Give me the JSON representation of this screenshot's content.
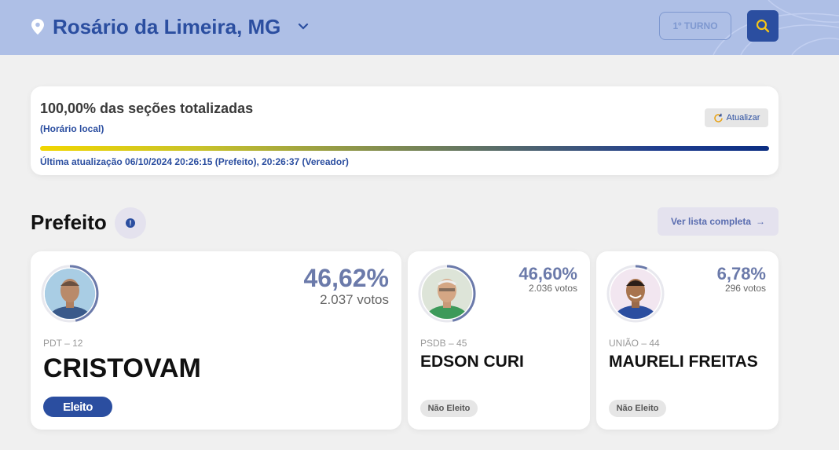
{
  "header": {
    "city": "Rosário da Limeira, MG",
    "turno_label": "1º TURNO"
  },
  "status": {
    "title": "100,00% das seções totalizadas",
    "subtitle": "(Horário local)",
    "refresh_label": "Atualizar",
    "progress": 1.0,
    "last_update": "Última atualização 06/10/2024 20:26:15 (Prefeito), 20:26:37 (Vereador)"
  },
  "section": {
    "title": "Prefeito",
    "info_icon": "!",
    "list_button": "Ver lista completa",
    "list_arrow": "→"
  },
  "candidates": [
    {
      "party": "PDT – 12",
      "name": "CRISTOVAM",
      "percent": "46,62%",
      "votes": "2.037 votos",
      "status": "Eleito",
      "share": 0.4662
    },
    {
      "party": "PSDB – 45",
      "name": "EDSON CURI",
      "percent": "46,60%",
      "votes": "2.036 votos",
      "status": "Não Eleito",
      "share": 0.466
    },
    {
      "party": "UNIÃO – 44",
      "name": "MAURELI FREITAS",
      "percent": "6,78%",
      "votes": "296 votos",
      "status": "Não Eleito",
      "share": 0.0678
    }
  ],
  "colors": {
    "brand": "#2b4ea0",
    "header_bg": "#aebfe6",
    "ring": "#6b7aaa"
  }
}
